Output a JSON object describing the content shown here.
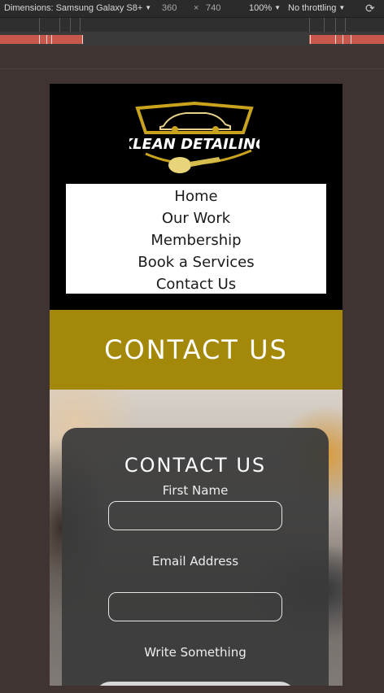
{
  "devtools": {
    "dimensions_label": "Dimensions: Samsung Galaxy S8+",
    "width": "360",
    "times": "×",
    "height": "740",
    "zoom": "100%",
    "throttling": "No throttling"
  },
  "site": {
    "logo_text": "KLEAN DETAILING",
    "nav": [
      "Home",
      "Our Work",
      "Membership",
      "Book a Services",
      "Contact Us"
    ],
    "banner_title": "CONTACT US",
    "form": {
      "title": "CONTACT US",
      "first_name_label": "First Name",
      "email_label": "Email Address",
      "message_label": "Write Something"
    }
  },
  "colors": {
    "banner": "#a38809",
    "logo_gold": "#c9a21e"
  }
}
